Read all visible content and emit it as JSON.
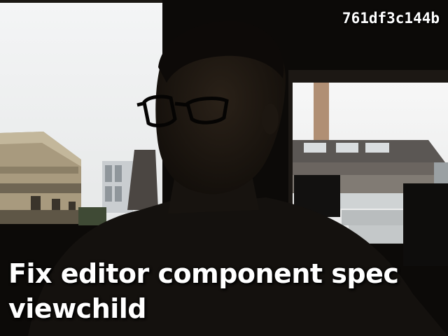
{
  "overlay": {
    "id_text": "761df3c144b",
    "caption_line_1": "Fix editor component spec",
    "caption_line_2": "viewchild"
  },
  "colors": {
    "caption_text": "#ffffff",
    "scene_dark": "#0c0a08"
  },
  "scene": {
    "subject": "silhouetted-person-with-glasses",
    "background": "window-view-of-buildings"
  }
}
